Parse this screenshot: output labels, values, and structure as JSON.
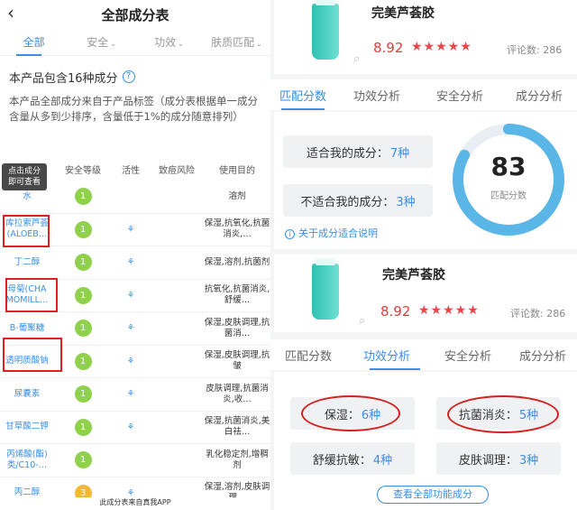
{
  "left": {
    "title": "全部成分表",
    "back": "‹",
    "tabs": [
      {
        "label": "全部",
        "caret": ""
      },
      {
        "label": "安全",
        "caret": "⌄"
      },
      {
        "label": "功效",
        "caret": "⌄"
      },
      {
        "label": "肤质匹配",
        "caret": "⌄"
      }
    ],
    "count_text": "本产品包含16种成分",
    "note": "本产品全部成分来自于产品标签（成分表根据单一成分含量从多到少排序，含量低于1%的成分随意排列）",
    "tooltip": "点击成分\n即可查看",
    "columns": [
      "成分",
      "安全等级",
      "活性",
      "致痘风险",
      "使用目的"
    ],
    "rows": [
      {
        "name": "水",
        "level": "1",
        "active": "",
        "use": "溶剂"
      },
      {
        "name": "库拉索芦荟 (ALOEB…",
        "level": "1",
        "active": "⚘",
        "use": "保湿,抗氧化,抗菌消炎,…"
      },
      {
        "name": "丁二醇",
        "level": "1",
        "active": "⚘",
        "use": "保湿,溶剂,抗菌剂"
      },
      {
        "name": "母菊(CHA MOMILL…",
        "level": "1",
        "active": "⚘",
        "use": "抗氧化,抗菌消炎,舒缓…"
      },
      {
        "name": "B-葡聚糖",
        "level": "1",
        "active": "⚘",
        "use": "保湿,皮肤调理,抗菌消…"
      },
      {
        "name": "透明质酸钠",
        "level": "1",
        "active": "⚘",
        "use": "保湿,皮肤调理,抗皱"
      },
      {
        "name": "尿囊素",
        "level": "1",
        "active": "⚘",
        "use": "皮肤调理,抗菌消炎,收…"
      },
      {
        "name": "甘草酸二钾",
        "level": "1",
        "active": "⚘",
        "use": "保湿,抗菌消炎,美白祛…"
      },
      {
        "name": "丙烯酸(酯)类/C10-…",
        "level": "1",
        "active": "",
        "use": "乳化稳定剂,增稠剂"
      },
      {
        "name": "丙二醇",
        "level": "3",
        "active": "⚘",
        "use": "保湿,溶剂,皮肤调理…"
      }
    ],
    "footer": "此成分表来自真我APP"
  },
  "product": {
    "name": "完美芦荟胶",
    "score": "8.92",
    "stars": "★★★★★",
    "reviews": "评论数: 286",
    "search_icon": "⌕"
  },
  "tabs_top": [
    "匹配分数",
    "功效分析",
    "安全分析",
    "成分分析"
  ],
  "match": {
    "suitable_label": "适合我的成分：",
    "suitable_value": "7种",
    "unsuitable_label": "不适合我的成分：",
    "unsuitable_value": "3种",
    "score": "83",
    "score_label": "匹配分数",
    "score_fraction": 0.83,
    "info": "关于成分适合说明"
  },
  "tabs_bottom": [
    "匹配分数",
    "功效分析",
    "安全分析",
    "成分分析"
  ],
  "efficacy": [
    {
      "label": "保湿：",
      "value": "6种"
    },
    {
      "label": "抗菌消炎：",
      "value": "5种"
    },
    {
      "label": "舒缓抗敏：",
      "value": "4种"
    },
    {
      "label": "皮肤调理：",
      "value": "3种"
    }
  ],
  "view_all": "查看全部功能成分",
  "colors": {
    "accent": "#3a8ee6",
    "star": "#e8474a",
    "badge_green": "#8fd14a",
    "badge_yellow": "#f3b932",
    "highlight": "#e02020"
  }
}
